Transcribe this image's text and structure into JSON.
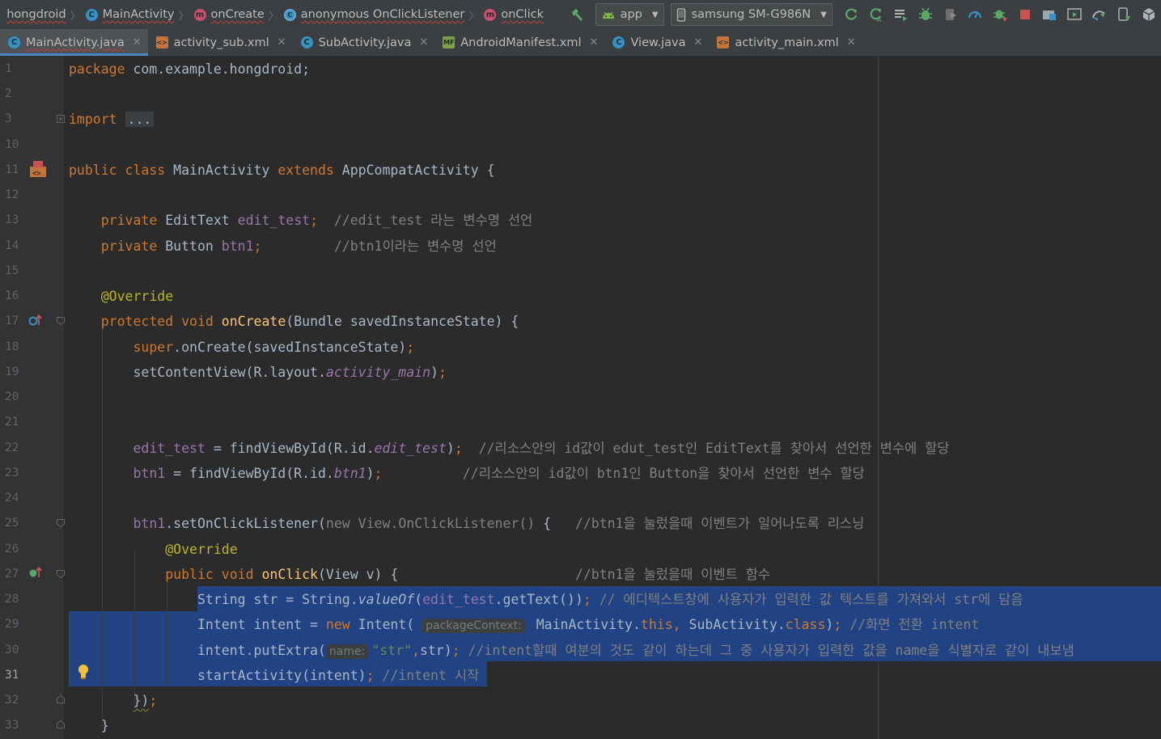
{
  "colors": {
    "background": "#2b2b2b",
    "gutter": "#313335",
    "chrome": "#3c3f41",
    "selection": "#214283",
    "keyword": "#cc7832",
    "function": "#ffc66d",
    "field": "#9876aa",
    "annotation": "#bbb529",
    "string": "#6a8759",
    "comment": "#808080",
    "text": "#a9b7c6"
  },
  "breadcrumb": [
    {
      "label": "hongdroid",
      "icon": "none"
    },
    {
      "label": "MainActivity",
      "icon": "class-icon"
    },
    {
      "label": "onCreate",
      "icon": "method-icon"
    },
    {
      "label": "anonymous OnClickListener",
      "icon": "anonymous-class-icon"
    },
    {
      "label": "onClick",
      "icon": "method-icon"
    }
  ],
  "toolbar": {
    "run_config": "app",
    "device": "samsung SM-G986N",
    "icons": [
      "hammer-icon",
      "apply-changes-restart-icon",
      "apply-code-changes-icon",
      "sync-icon",
      "debug-icon",
      "coverage-icon",
      "profile-icon",
      "attach-debugger-icon",
      "stop-icon",
      "project-structure-icon",
      "avd-manager-icon",
      "sync-gradle-icon",
      "device-manager-icon",
      "sdk-manager-icon"
    ]
  },
  "tabs": [
    {
      "label": "MainActivity.java",
      "type": "java",
      "active": true,
      "error": true
    },
    {
      "label": "activity_sub.xml",
      "type": "xml",
      "active": false,
      "error": false
    },
    {
      "label": "SubActivity.java",
      "type": "java",
      "active": false,
      "error": false
    },
    {
      "label": "AndroidManifest.xml",
      "type": "manifest",
      "active": false,
      "error": false
    },
    {
      "label": "View.java",
      "type": "java",
      "active": false,
      "error": false
    },
    {
      "label": "activity_main.xml",
      "type": "xml",
      "active": false,
      "error": false
    }
  ],
  "line_numbers": [
    "1",
    "2",
    "3",
    "10",
    "11",
    "12",
    "13",
    "14",
    "15",
    "16",
    "17",
    "18",
    "19",
    "20",
    "21",
    "22",
    "23",
    "24",
    "25",
    "26",
    "27",
    "28",
    "29",
    "30",
    "31",
    "32",
    "33"
  ],
  "current_line": "31",
  "code": {
    "l1": {
      "kw": "package",
      "rest": " com.example.hongdroid;"
    },
    "l3": {
      "kw": "import",
      "dots": "..."
    },
    "l11": {
      "kw1": "public",
      "kw2": "class",
      "name": "MainActivity",
      "kw3": "extends",
      "rest": "AppCompatActivity {"
    },
    "l13": {
      "kw": "private",
      "type": "EditText",
      "field": "edit_test",
      "semi": ";",
      "comment": "//edit_test 라는 변수명 선언"
    },
    "l14": {
      "kw": "private",
      "type": "Button",
      "field": "btn1",
      "semi": ";",
      "comment": "//btn1이라는 변수명 선언"
    },
    "l16": {
      "ann": "@Override"
    },
    "l17": {
      "kw1": "protected",
      "kw2": "void",
      "fn": "onCreate",
      "rest": "(Bundle savedInstanceState) {"
    },
    "l18": {
      "kw": "super",
      "rest": ".onCreate(savedInstanceState)",
      "semi": ";"
    },
    "l19": {
      "pre": "setContentView(R.layout.",
      "ital": "activity_main",
      "post": ")",
      "semi": ";"
    },
    "l22": {
      "field": "edit_test",
      "pre": " = findViewById(R.id.",
      "ital": "edit_test",
      "post": ")",
      "semi": ";",
      "comment": "//리소스안의 id값이 edut_test인 EditText를 찾아서 선언한 변수에 할당"
    },
    "l23": {
      "field": "btn1",
      "pre": " = findViewById(R.id.",
      "ital": "btn1",
      "post": ")",
      "semi": ";",
      "comment": "//리소스안의 id값이 btn1인 Button을 찾아서 선언한 변수 할당"
    },
    "l25": {
      "field": "btn1",
      "pre": ".setOnClickListener(",
      "gray": "new View.OnClickListener()",
      "post": " {",
      "comment": "//btn1을 눌렀을때 이벤트가 일어나도록 리스닝"
    },
    "l26": {
      "ann": "@Override"
    },
    "l27": {
      "kw1": "public",
      "kw2": "void",
      "fn": "onClick",
      "rest": "(View v) {",
      "comment": "//btn1을 눌렀을때 이벤트 함수"
    },
    "l28": {
      "pre": "String str = String.",
      "ital": "valueOf",
      "paren": "(",
      "field": "edit_test",
      "post": ".getText())",
      "semi": ";",
      "comment": "// 에디텍스트창에 사용자가 입력한 값 텍스트를 가져와서 str에 담음"
    },
    "l29": {
      "pre": "Intent intent = ",
      "kw": "new",
      "mid": " Intent(",
      "hint": "packageContext:",
      "arg1": " MainActivity.",
      "kw2": "this",
      "comma": ",",
      "arg2": " SubActivity.",
      "kw3": "class",
      "post": ")",
      "semi": ";",
      "comment": " //화면 전환 intent"
    },
    "l30": {
      "pre": "intent.putExtra(",
      "hint": "name:",
      "str": "\"str\"",
      "comma": ",",
      "post": "str)",
      "semi": ";",
      "comment": " //intent할때 여분의 것도 같이 하는데 그 중 사용자가 입력한 값을 name을 식별자로 같이 내보냄"
    },
    "l31": {
      "pre": "startActivity(intent)",
      "semi": ";",
      "comment": " //intent 시작"
    },
    "l32": {
      "rest": "})",
      "semi": ";"
    },
    "l33": {
      "rest": "}"
    }
  }
}
